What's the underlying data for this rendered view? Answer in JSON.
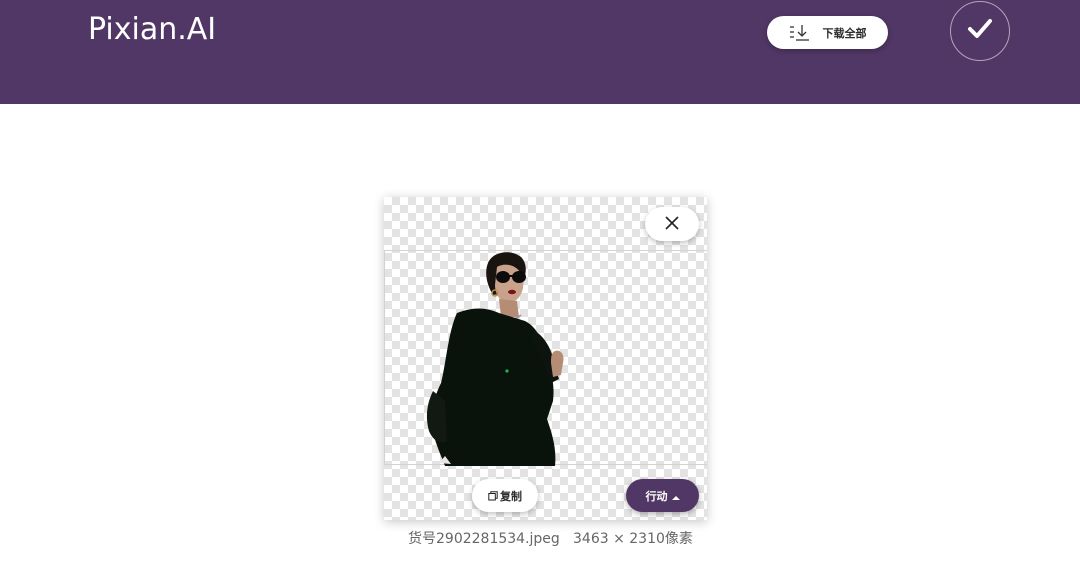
{
  "header": {
    "logo": "Pixian.AI",
    "download_all_label": "下载全部",
    "download_icon": "download-list-icon",
    "confirm_icon": "checkmark-icon"
  },
  "card": {
    "close_icon": "close-icon",
    "copy_label": "复制",
    "copy_icon": "copy-icon",
    "action_label": "行动",
    "action_icon": "caret-up-icon"
  },
  "file": {
    "name": "货号2902281534.jpeg",
    "dimensions": "3463 × 2310像素"
  },
  "colors": {
    "brand": "#513766",
    "checker": "#e3e3e3"
  }
}
